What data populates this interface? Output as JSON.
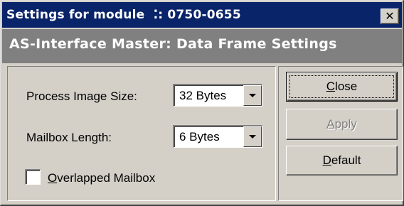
{
  "window": {
    "title": "Settings for module  ⁚: 0750-0655",
    "close_glyph": "✕"
  },
  "header": {
    "title": "AS-Interface Master: Data Frame Settings"
  },
  "form": {
    "process_image_size": {
      "label": "Process Image Size:",
      "value": "32 Bytes"
    },
    "mailbox_length": {
      "label": "Mailbox Length:",
      "value": "6 Bytes"
    },
    "overlapped_mailbox": {
      "label": "Overlapped Mailbox",
      "checked": false
    }
  },
  "buttons": {
    "close": "Close",
    "apply": "Apply",
    "default": "Default"
  },
  "colors": {
    "titlebar": "#0a246a",
    "header_band": "#808080",
    "face": "#d4d0c8",
    "disabled_text": "#808080"
  },
  "icons": {
    "title_close": "close-icon",
    "combo_arrow": "chevron-down-icon"
  }
}
